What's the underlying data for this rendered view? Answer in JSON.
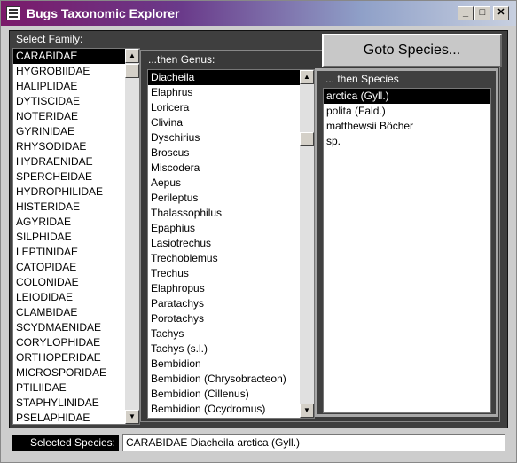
{
  "window": {
    "title": "Bugs Taxonomic Explorer",
    "controls": {
      "minimize": "_",
      "maximize": "□",
      "close": "✕"
    }
  },
  "family": {
    "label": "Select Family:",
    "selected_index": 0,
    "items": [
      "CARABIDAE",
      "HYGROBIIDAE",
      "HALIPLIDAE",
      "DYTISCIDAE",
      "NOTERIDAE",
      "GYRINIDAE",
      "RHYSODIDAE",
      "HYDRAENIDAE",
      "SPERCHEIDAE",
      "HYDROPHILIDAE",
      "HISTERIDAE",
      "AGYRIDAE",
      "SILPHIDAE",
      "LEPTINIDAE",
      "CATOPIDAE",
      "COLONIDAE",
      "LEIODIDAE",
      "CLAMBIDAE",
      "SCYDMAENIDAE",
      "CORYLOPHIDAE",
      "ORTHOPERIDAE",
      "MICROSPORIDAE",
      "PTILIIDAE",
      "STAPHYLINIDAE",
      "PSELAPHIDAE"
    ]
  },
  "genus": {
    "label": "...then Genus:",
    "selected_index": 0,
    "items": [
      "Diacheila",
      "Elaphrus",
      "Loricera",
      "Clivina",
      "Dyschirius",
      "Broscus",
      "Miscodera",
      "Aepus",
      "Perileptus",
      "Thalassophilus",
      "Epaphius",
      "Lasiotrechus",
      "Trechoblemus",
      "Trechus",
      "Elaphropus",
      "Paratachys",
      "Porotachys",
      "Tachys",
      "Tachys (s.l.)",
      "Bembidion",
      "Bembidion (Chrysobracteon)",
      "Bembidion (Cillenus)",
      "Bembidion (Ocydromus)"
    ]
  },
  "species": {
    "label": "... then Species",
    "selected_index": 0,
    "items": [
      "arctica (Gyll.)",
      "polita (Fald.)",
      "matthewsii Böcher",
      "sp."
    ]
  },
  "goto_button": {
    "label": "Goto Species..."
  },
  "selected_species": {
    "label": "Selected Species:",
    "value": "CARABIDAE Diacheila arctica (Gyll.)"
  },
  "scroll": {
    "up": "▲",
    "down": "▼"
  }
}
